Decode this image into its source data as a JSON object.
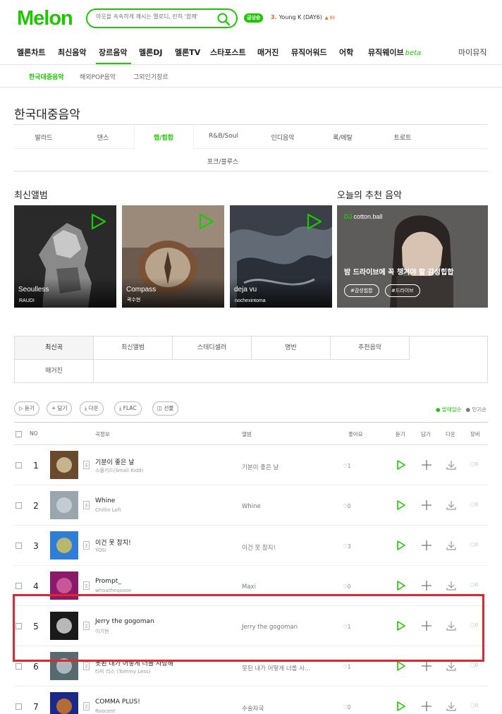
{
  "header": {
    "logo": "Melon",
    "search_placeholder": "아웃을 속속하게 깨시는 멜로디, 린히 '함께'",
    "realtime_badge": "급상승",
    "realtime_rank": "3.",
    "realtime_text": "Young K (DAY6)",
    "realtime_change": "▲ 89"
  },
  "gnb": {
    "items": [
      "멜론차트",
      "최신음악",
      "장르음악",
      "멜론DJ",
      "멜론TV",
      "스타포스트",
      "매거진",
      "뮤직어워드",
      "어학",
      "뮤직웨이브"
    ],
    "beta": "beta",
    "my": "마이뮤직"
  },
  "subgnb": [
    "한국대중음악",
    "해외POP음악",
    "그외인기장르"
  ],
  "page_title": "한국대중음악",
  "genres": [
    "발라드",
    "댄스",
    "랩/힙합",
    "R&B/Soul",
    "인디음악",
    "록/메탈",
    "트로트",
    "포크/블루스"
  ],
  "sections": {
    "new_albums": "최신앨범",
    "today_reco": "오늘의 추천 음악"
  },
  "albums": [
    {
      "title": "Seoulless",
      "artist": "RAUDI"
    },
    {
      "title": "Compass",
      "artist": "곽수현"
    },
    {
      "title": "deja vu",
      "artist": "nochexintoma"
    }
  ],
  "reco": {
    "dj_label": "DJ",
    "dj_name": "cotton.ball",
    "title": "밤 드라이브에 꼭 챙겨야 할 감성힙합",
    "tags": [
      "#감성힙합",
      "#드라이브"
    ]
  },
  "song_tabs": [
    "최신곡",
    "최신앨범",
    "스테디셀러",
    "명반",
    "추천음악",
    "매거진"
  ],
  "toolbar": {
    "buttons": [
      "듣기",
      "담기",
      "다운",
      "FLAC",
      "선물"
    ],
    "sort_selected": "● 발매일순",
    "sort_other": "● 인기순"
  },
  "table": {
    "headers": {
      "no": "NO",
      "song": "곡정보",
      "album": "앨범",
      "like": "좋아요",
      "play": "듣기",
      "add": "담기",
      "down": "다운",
      "mv": "뮤비"
    },
    "rows": [
      {
        "rank": "1",
        "title": "기분이 좋은 날",
        "artist": "스몰키드(Small Kidd)",
        "album": "기분이 좋은 날",
        "likes": "1",
        "mv": "0"
      },
      {
        "rank": "2",
        "title": "Whine",
        "artist": "Chillin Lofi",
        "album": "Whine",
        "likes": "0",
        "mv": "0"
      },
      {
        "rank": "3",
        "title": "이건 못 참지!",
        "artist": "YOSI",
        "album": "이건 못 참지!",
        "likes": "3",
        "mv": "0"
      },
      {
        "rank": "4",
        "title": "Prompt_",
        "artist": "whoatheqoose",
        "album": "Maxi",
        "likes": "0",
        "mv": "0"
      },
      {
        "rank": "5",
        "title": "Jerry the gogoman",
        "artist": "이기현",
        "album": "Jerry the gogoman",
        "likes": "1",
        "mv": "0"
      },
      {
        "rank": "6",
        "title": "못된 내가 어떻게 너를 사랑해",
        "artist": "타미 리스 (Tommy Less)",
        "album": "못된 내가 어떻게 너를 사...",
        "likes": "1",
        "mv": "0"
      },
      {
        "rank": "7",
        "title": "COMMA PLUS!",
        "artist": "Roocent",
        "album": "수술자국",
        "likes": "0",
        "mv": "0"
      }
    ]
  },
  "colors": {
    "brand": "#1ec800",
    "highlight": "#e0262e"
  }
}
